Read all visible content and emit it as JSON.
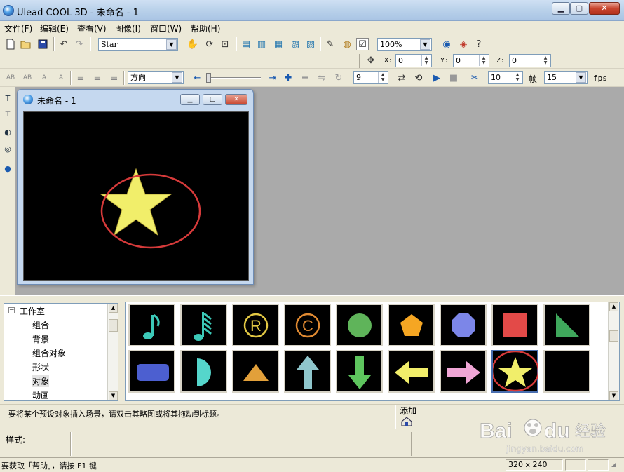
{
  "window": {
    "title": "Ulead COOL 3D - 未命名 - 1",
    "min": "▁",
    "max": "▢",
    "close": "✕"
  },
  "menu": [
    "文件(F)",
    "编辑(E)",
    "查看(V)",
    "图像(I)",
    "窗口(W)",
    "帮助(H)"
  ],
  "toolbar1": {
    "object_combo": "Star",
    "zoom_combo": "100%"
  },
  "toolbar2": {
    "x_label": "X:",
    "x_value": "0",
    "y_label": "Y:",
    "y_value": "0",
    "z_label": "Z:",
    "z_value": "0"
  },
  "toolbar3": {
    "direction_combo": "方向",
    "frame_value": "9",
    "frame_count": "10",
    "frame_label": "帧",
    "fps_value": "15",
    "fps_label": "fps",
    "text_tools": [
      "AB",
      "AB",
      "A",
      "A"
    ]
  },
  "document": {
    "title": "未命名 - 1",
    "star_color": "#f1ee6a",
    "highlight_color": "#d63a3a"
  },
  "tree": {
    "root": "工作室",
    "expander": "−",
    "items": [
      "组合",
      "背景",
      "组合对象",
      "形状",
      "对象",
      "动画"
    ]
  },
  "gallery": {
    "items": [
      {
        "icon": "music-note-icon",
        "color": "#3cc9b8"
      },
      {
        "icon": "double-music-note-icon",
        "color": "#3cc9b8"
      },
      {
        "icon": "registered-icon",
        "color": "#e3c944"
      },
      {
        "icon": "copyright-icon",
        "color": "#e08a32"
      },
      {
        "icon": "circle-icon",
        "color": "#5fb45a"
      },
      {
        "icon": "pentagon-icon",
        "color": "#f5a623"
      },
      {
        "icon": "octagon-icon",
        "color": "#7c86e8"
      },
      {
        "icon": "square-icon",
        "color": "#e34a48"
      },
      {
        "icon": "triangle-right-icon",
        "color": "#3fa85c"
      },
      {
        "icon": "rounded-rect-icon",
        "color": "#4c5fd0"
      },
      {
        "icon": "half-circle-icon",
        "color": "#55d6cb"
      },
      {
        "icon": "triangle-icon",
        "color": "#e2a03a"
      },
      {
        "icon": "arrow-up-icon",
        "color": "#8fc6cc"
      },
      {
        "icon": "arrow-down-icon",
        "color": "#5ec55e"
      },
      {
        "icon": "arrow-left-icon",
        "color": "#f1ee6a"
      },
      {
        "icon": "arrow-right-icon",
        "color": "#f0a6d6"
      },
      {
        "icon": "star-icon",
        "color": "#f1ee6a"
      },
      {
        "icon": "crescent-icon",
        "color": "#e8e26a"
      }
    ],
    "selected_index": 16
  },
  "hint": "要将某个预设对象插入场景，请双击其略图或将其拖动到标题。",
  "add_label": "添加",
  "style_label": "样式:",
  "status": {
    "text": "要获取「帮助」，请按 F1 键",
    "size": "320 x 240"
  },
  "watermark": {
    "brand": "Bai",
    "brand2": "du",
    "cn": "经验",
    "url": "jingyan.baidu.com"
  }
}
